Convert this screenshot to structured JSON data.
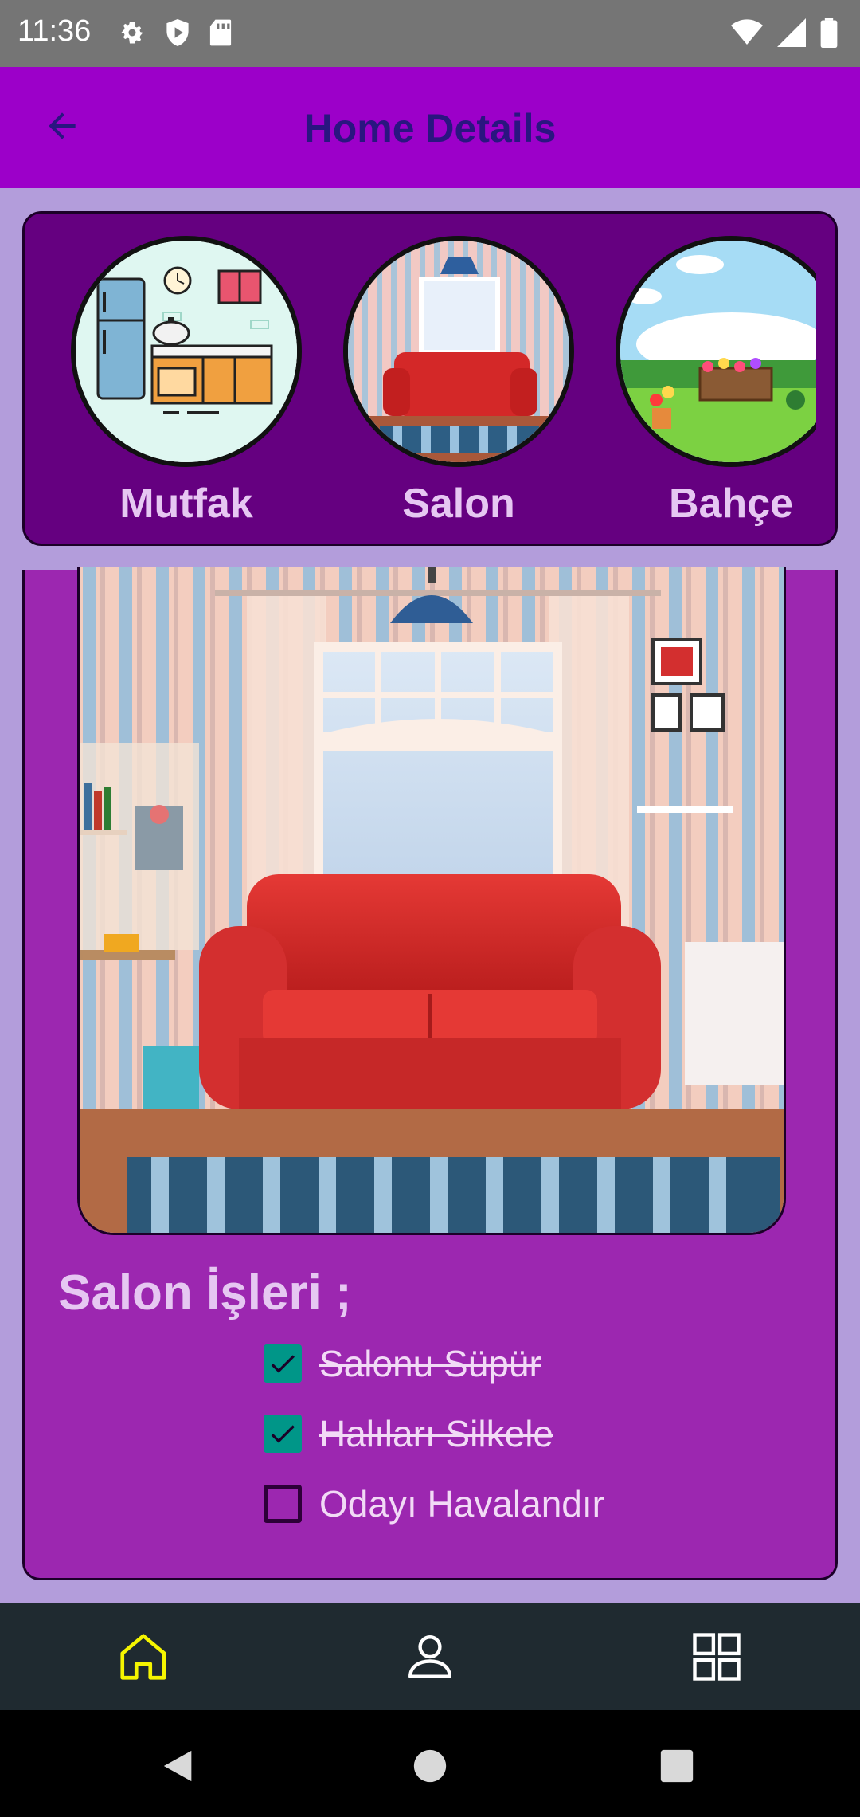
{
  "status_bar": {
    "time": "11:36",
    "left_icons": [
      "gear-icon",
      "play-shield-icon",
      "sd-card-icon"
    ],
    "right_icons": [
      "wifi-icon",
      "cell-signal-icon",
      "battery-icon"
    ]
  },
  "app_bar": {
    "back_icon": "arrow-back-icon",
    "title": "Home Details",
    "background": "#9c00c9",
    "title_color": "#2a1580"
  },
  "rooms": {
    "items": [
      {
        "label": "Mutfak",
        "image": "kitchen-illustration"
      },
      {
        "label": "Salon",
        "image": "living-room-photo"
      },
      {
        "label": "Bahçe",
        "image": "garden-illustration"
      }
    ],
    "panel_color": "#650080",
    "label_color": "#e6c7f2"
  },
  "selected_room": {
    "image": "living-room-red-sofa-photo",
    "tasks_title": "Salon İşleri ;",
    "tasks": [
      {
        "label": "Salonu Süpür",
        "checked": true
      },
      {
        "label": "Halıları Silkele",
        "checked": true
      },
      {
        "label": "Odayı Havalandır",
        "checked": false
      }
    ],
    "card_color": "#9c27b0",
    "checkbox_color": "#009688"
  },
  "bottom_nav": {
    "items": [
      {
        "icon": "home-icon",
        "active": true
      },
      {
        "icon": "person-icon",
        "active": false
      },
      {
        "icon": "grid-icon",
        "active": false
      }
    ],
    "active_color": "#f5f500",
    "inactive_color": "#ffffff"
  },
  "system_nav": [
    "back-triangle-icon",
    "home-circle-icon",
    "recents-square-icon"
  ]
}
